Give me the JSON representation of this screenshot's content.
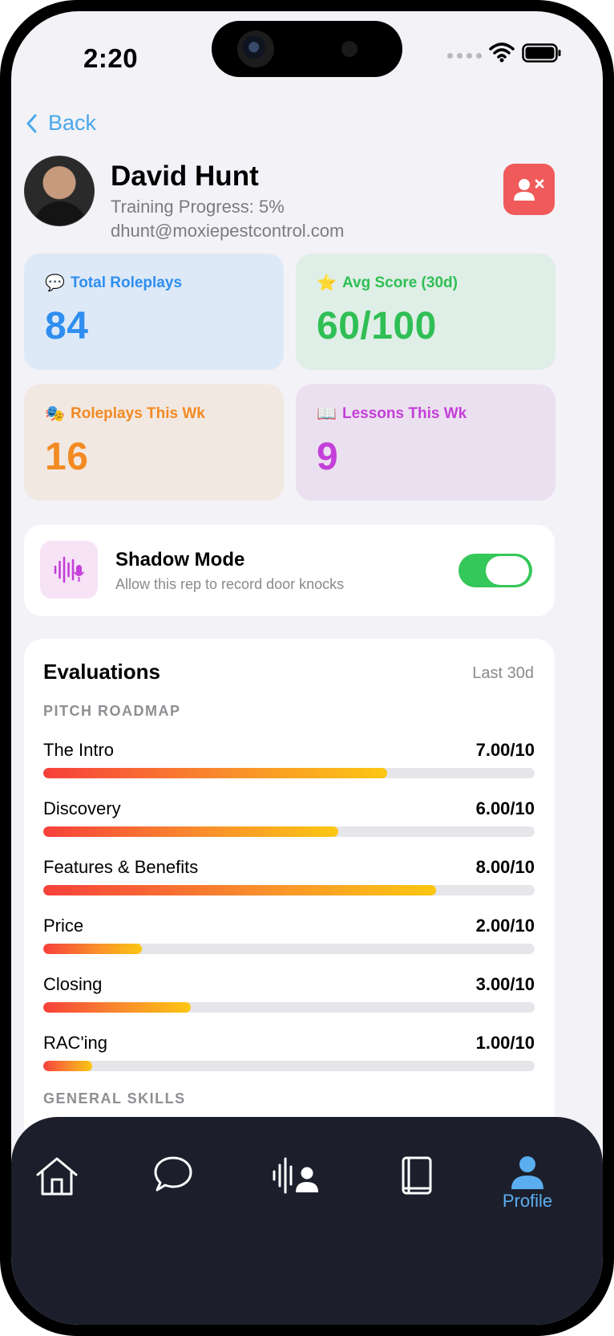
{
  "status_bar": {
    "time": "2:20"
  },
  "nav": {
    "back_label": "Back"
  },
  "profile": {
    "name": "David Hunt",
    "training_progress": "Training Progress: 5%",
    "email": "dhunt@moxiepestcontrol.com"
  },
  "stats": [
    {
      "emoji": "💬",
      "label": "Total Roleplays",
      "value": "84",
      "color": "#2f8ef0"
    },
    {
      "emoji": "⭐",
      "label": "Avg Score (30d)",
      "value": "60/100",
      "color": "#2fbf55"
    },
    {
      "emoji": "🎭",
      "label": "Roleplays This Wk",
      "value": "16",
      "color": "#f28a22"
    },
    {
      "emoji": "📖",
      "label": "Lessons This Wk",
      "value": "9",
      "color": "#c43fd9"
    }
  ],
  "shadow_mode": {
    "title": "Shadow Mode",
    "subtitle": "Allow this rep to record door knocks",
    "enabled": true
  },
  "evaluations": {
    "title": "Evaluations",
    "range": "Last 30d",
    "sections": [
      {
        "heading": "PITCH ROADMAP",
        "items": [
          {
            "label": "The Intro",
            "score": "7.00/10",
            "fraction": 0.7
          },
          {
            "label": "Discovery",
            "score": "6.00/10",
            "fraction": 0.6
          },
          {
            "label": "Features & Benefits",
            "score": "8.00/10",
            "fraction": 0.8
          },
          {
            "label": "Price",
            "score": "2.00/10",
            "fraction": 0.2
          },
          {
            "label": "Closing",
            "score": "3.00/10",
            "fraction": 0.3
          },
          {
            "label": "RAC'ing",
            "score": "1.00/10",
            "fraction": 0.1
          }
        ]
      },
      {
        "heading": "GENERAL SKILLS",
        "items": []
      }
    ]
  },
  "tabbar": {
    "tabs": [
      {
        "icon": "home-icon",
        "label": ""
      },
      {
        "icon": "chat-bubble-icon",
        "label": ""
      },
      {
        "icon": "voice-person-icon",
        "label": ""
      },
      {
        "icon": "book-icon",
        "label": ""
      },
      {
        "icon": "person-icon",
        "label": "Profile",
        "active": true
      }
    ],
    "active_color": "#5aaef0"
  }
}
